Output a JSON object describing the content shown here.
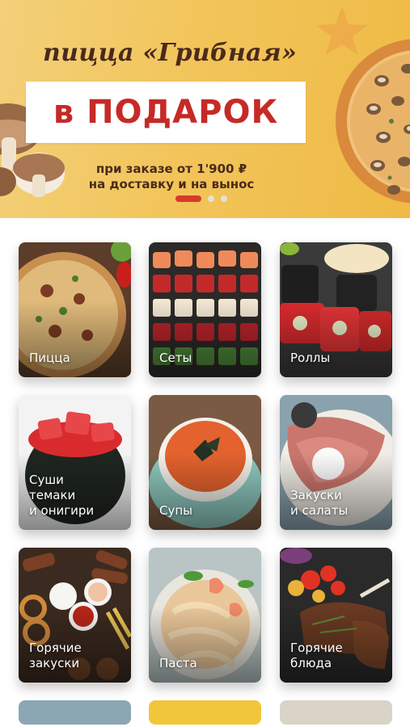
{
  "banner": {
    "title": "пицца «Грибная»",
    "gift_text": "в ПОДАРОК",
    "subtitle_line1": "при заказе от 1'900 ₽",
    "subtitle_line2": "на доставку и на вынос",
    "slide_count": 3,
    "active_slide": 1
  },
  "categories": [
    {
      "label": "Пицца"
    },
    {
      "label": "Сеты"
    },
    {
      "label": "Роллы"
    },
    {
      "label": "Суши\nтемаки\nи онигири"
    },
    {
      "label": "Супы"
    },
    {
      "label": "Закуски\nи салаты"
    },
    {
      "label": "Горячие\nзакуски"
    },
    {
      "label": "Паста"
    },
    {
      "label": "Горячие\nблюда"
    }
  ],
  "colors": {
    "banner_bg": "#f2c55a",
    "gift_text": "#c62a26",
    "title_text": "#4a2a1c",
    "active_dot": "#d63a2d",
    "inactive_dot": "#e5e1da"
  }
}
